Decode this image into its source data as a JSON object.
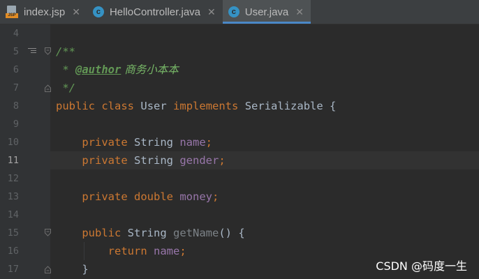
{
  "tabs": [
    {
      "label": "index.jsp",
      "icon": "jsp-file-icon",
      "active": false
    },
    {
      "label": "HelloController.java",
      "icon": "java-class-icon",
      "active": false
    },
    {
      "label": "User.java",
      "icon": "java-class-icon",
      "active": true
    }
  ],
  "tab_close_glyph": "✕",
  "class_icon_letter": "c",
  "jsp_icon_text": "JSP",
  "editor": {
    "current_line": 11,
    "line_numbers": [
      "4",
      "5",
      "6",
      "7",
      "8",
      "9",
      "10",
      "11",
      "12",
      "13",
      "14",
      "15",
      "16",
      "17"
    ],
    "lines": {
      "l5": {
        "text": "/**"
      },
      "l6": {
        "prefix": " * ",
        "tag": "@author",
        "value": " 商务小本本"
      },
      "l7": {
        "text": " */"
      },
      "l8": {
        "kw1": "public",
        "kw2": "class",
        "name": "User",
        "kw3": "implements",
        "iface": "Serializable",
        "brace": "{"
      },
      "l10": {
        "kw": "private",
        "type": "String",
        "field": "name",
        "end": ";"
      },
      "l11": {
        "kw": "private",
        "type": "String",
        "field": "gender",
        "end": ";"
      },
      "l13": {
        "kw": "private",
        "kw2": "double",
        "field": "money",
        "end": ";"
      },
      "l15": {
        "kw": "public",
        "type": "String",
        "method": "getName",
        "rest": "() {"
      },
      "l16": {
        "kw": "return",
        "field": "name",
        "end": ";"
      },
      "l17": {
        "text": "}"
      }
    }
  },
  "colors": {
    "keyword": "#cc7832",
    "field": "#9876aa",
    "doc_comment": "#629755",
    "text": "#a9b7c6",
    "background": "#2b2b2b",
    "tab_underline": "#4a88c7"
  },
  "watermark": "CSDN @码度一生"
}
